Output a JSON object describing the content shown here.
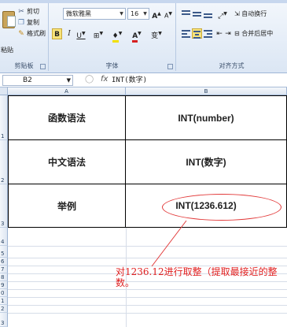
{
  "ribbon": {
    "clipboard": {
      "paste_label": "粘贴",
      "cut_label": "剪切",
      "copy_label": "复制",
      "format_painter_label": "格式刷",
      "group_label": "剪贴板"
    },
    "font": {
      "font_name": "微软雅黑",
      "font_size": "16",
      "grow_label": "A",
      "shrink_label": "A",
      "bold_label": "B",
      "italic_label": "I",
      "underline_label": "U",
      "wen_label": "变",
      "group_label": "字体"
    },
    "alignment": {
      "wrap_text_label": "自动换行",
      "merge_center_label": "合并后居中",
      "group_label": "对齐方式"
    }
  },
  "formula_bar": {
    "name_box": "B2",
    "fx_label": "fx",
    "formula": "INT(数字)"
  },
  "columns": [
    "A",
    "B"
  ],
  "rows": [
    "1",
    "2",
    "3",
    "4",
    "5",
    "6",
    "7",
    "8",
    "9",
    "0",
    "1",
    "2",
    "3"
  ],
  "table": [
    {
      "label": "函数语法",
      "value": "INT(number)"
    },
    {
      "label": "中文语法",
      "value": "INT(数字)"
    },
    {
      "label": "举例",
      "value": "INT(1236.612)"
    }
  ],
  "annotation": {
    "text": "对1236.12进行取整（提取最接近的整数。",
    "color": "#e02020"
  }
}
